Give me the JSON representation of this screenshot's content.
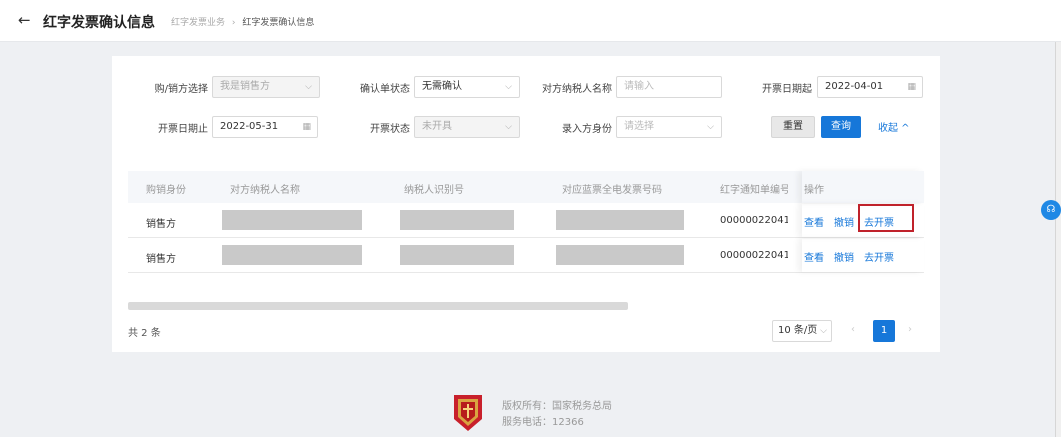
{
  "header": {
    "back_icon": "←",
    "title": "红字发票确认信息",
    "breadcrumb": {
      "parent": "红字发票业务",
      "separator": "›",
      "current": "红字发票确认信息"
    }
  },
  "filters": {
    "buyer_seller": {
      "label": "购/销方选择",
      "value": "我是销售方"
    },
    "confirm_status": {
      "label": "确认单状态",
      "value": "无需确认"
    },
    "counterparty_name": {
      "label": "对方纳税人名称",
      "placeholder": "请输入"
    },
    "date_start": {
      "label": "开票日期起",
      "value": "2022-04-01"
    },
    "date_end": {
      "label": "开票日期止",
      "value": "2022-05-31"
    },
    "invoice_status": {
      "label": "开票状态",
      "value": "未开具"
    },
    "entry_role": {
      "label": "录入方身份",
      "placeholder": "请选择"
    },
    "reset_label": "重置",
    "query_label": "查询",
    "collapse_label": "收起 ^"
  },
  "table": {
    "columns": [
      "购销身份",
      "对方纳税人名称",
      "纳税人识别号",
      "对应蓝票全电发票号码",
      "红字通知单编号",
      "操作"
    ],
    "rows": [
      {
        "role": "销售方",
        "notice_no": "000000220410",
        "actions": [
          "查看",
          "撤销",
          "去开票"
        ]
      },
      {
        "role": "销售方",
        "notice_no": "000000220410",
        "actions": [
          "查看",
          "撤销",
          "去开票"
        ]
      }
    ]
  },
  "pagination": {
    "total": "共 2 条",
    "page_size": "10 条/页",
    "prev": "‹",
    "current": "1",
    "next": "›"
  },
  "footer": {
    "copyright": "版权所有：国家税务总局",
    "phone": "服务电话：12366"
  },
  "colors": {
    "accent": "#1677d9",
    "highlight_border": "#c0222b"
  }
}
